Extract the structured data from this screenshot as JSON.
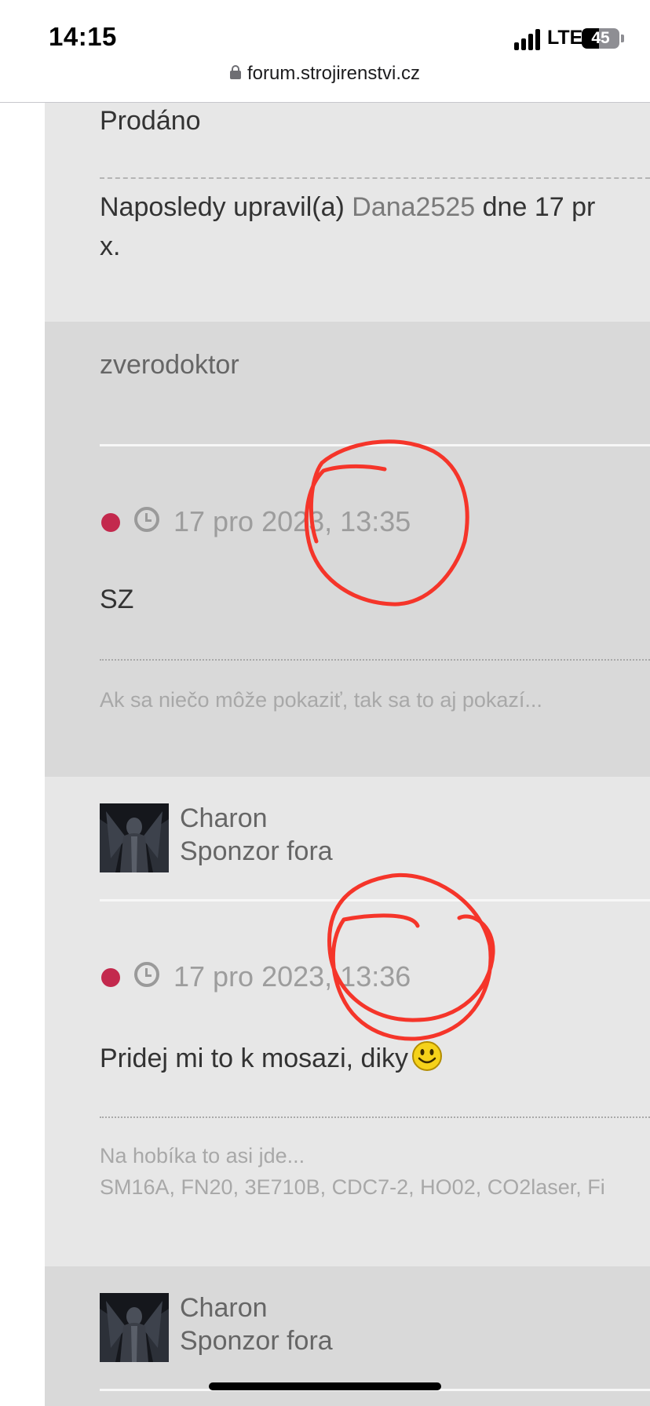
{
  "status_bar": {
    "time": "14:15",
    "network": "LTE",
    "battery": "45",
    "battery_level": 0.45
  },
  "browser": {
    "url": "forum.strojirenstvi.cz"
  },
  "posts": [
    {
      "body": "Prodáno",
      "edit_prefix": "Naposledy upravil(a)",
      "edit_user": "Dana2525",
      "edit_suffix": "dne 17 pr",
      "edit_line2": "x."
    },
    {
      "author": "zverodoktor",
      "datetime": "17 pro 2023, 13:35",
      "body": "SZ",
      "signature": "Ak sa niečo môže pokaziť, tak sa to aj pokazí..."
    },
    {
      "author": "Charon",
      "rank": "Sponzor fora",
      "datetime": "17 pro 2023, 13:36",
      "body": "Pridej mi to k mosazi, diky",
      "signature_line1": "Na hobíka to asi jde...",
      "signature_line2": "SM16A, FN20, 3E710B, CDC7-2, HO02, CO2laser, Fi"
    },
    {
      "author": "Charon",
      "rank": "Sponzor fora"
    }
  ],
  "colors": {
    "unread_dot": "#c3294d",
    "annotation": "#f5352a",
    "post_light": "#e7e7e7",
    "post_dark": "#d9d9d9"
  }
}
